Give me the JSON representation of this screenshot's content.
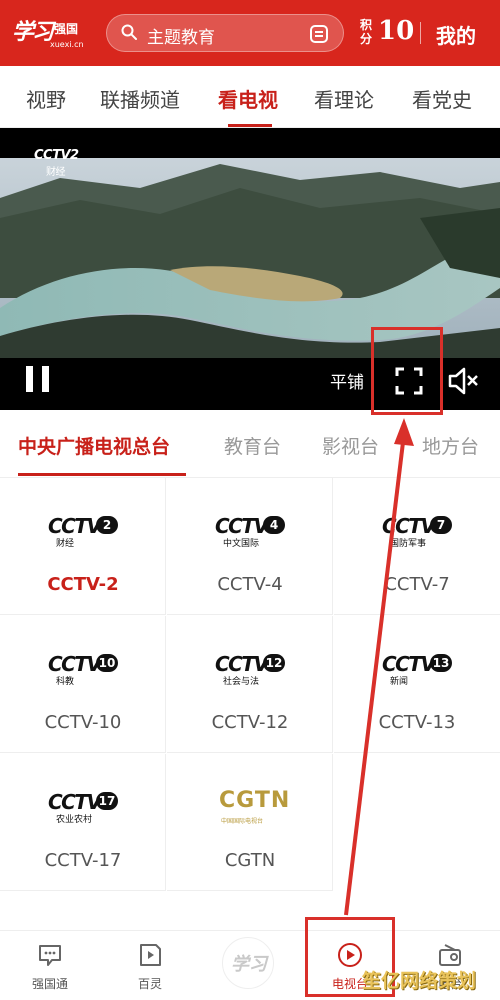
{
  "header": {
    "logo_script": "学习",
    "logo_brand": "强国",
    "logo_url": "xuexi.cn",
    "search_text": "主题教育",
    "score_label": "积分",
    "score_value": "10",
    "mine_label": "我的",
    "accent": "#d8261d"
  },
  "nav": {
    "tabs": [
      {
        "label": "视野"
      },
      {
        "label": "联播频道"
      },
      {
        "label": "看电视"
      },
      {
        "label": "看理论"
      },
      {
        "label": "看党史"
      }
    ],
    "active_index": 2
  },
  "player": {
    "badge_channel": "CCTV2",
    "badge_sub": "财经",
    "flat_label": "平铺",
    "controls": [
      "pause-icon",
      "fullscreen-icon",
      "mute-icon"
    ]
  },
  "categories": {
    "items": [
      {
        "label": "中央广播电视总台"
      },
      {
        "label": "教育台"
      },
      {
        "label": "影视台"
      },
      {
        "label": "地方台"
      }
    ],
    "active_index": 0
  },
  "channels": [
    {
      "mark": "CCTV",
      "num": "2",
      "sub": "财经",
      "name": "CCTV-2",
      "active": true
    },
    {
      "mark": "CCTV",
      "num": "4",
      "sub": "中文国际",
      "name": "CCTV-4",
      "active": false
    },
    {
      "mark": "CCTV",
      "num": "7",
      "sub": "国防军事",
      "name": "CCTV-7",
      "active": false
    },
    {
      "mark": "CCTV",
      "num": "10",
      "sub": "科教",
      "name": "CCTV-10",
      "active": false
    },
    {
      "mark": "CCTV",
      "num": "12",
      "sub": "社会与法",
      "name": "CCTV-12",
      "active": false
    },
    {
      "mark": "CCTV",
      "num": "13",
      "sub": "新闻",
      "name": "CCTV-13",
      "active": false
    },
    {
      "mark": "CCTV",
      "num": "17",
      "sub": "农业农村",
      "name": "CCTV-17",
      "active": false
    },
    {
      "mark": "CGTN",
      "num": "",
      "sub": "中国国际电视台",
      "name": "CGTN",
      "active": false
    }
  ],
  "bottom_nav": {
    "items": [
      {
        "label": "强国通",
        "icon": "chat-icon"
      },
      {
        "label": "百灵",
        "icon": "play-card-icon"
      },
      {
        "label": "学习",
        "icon": "xuexi-logo"
      },
      {
        "label": "电视台",
        "icon": "play-circle-icon"
      },
      {
        "label": "电台",
        "icon": "radio-icon"
      }
    ],
    "active_index": 3
  },
  "watermark": "笙亿网络策划",
  "colors": {
    "red": "#c8211a",
    "annotation": "#d9302a",
    "muted": "#999999"
  }
}
